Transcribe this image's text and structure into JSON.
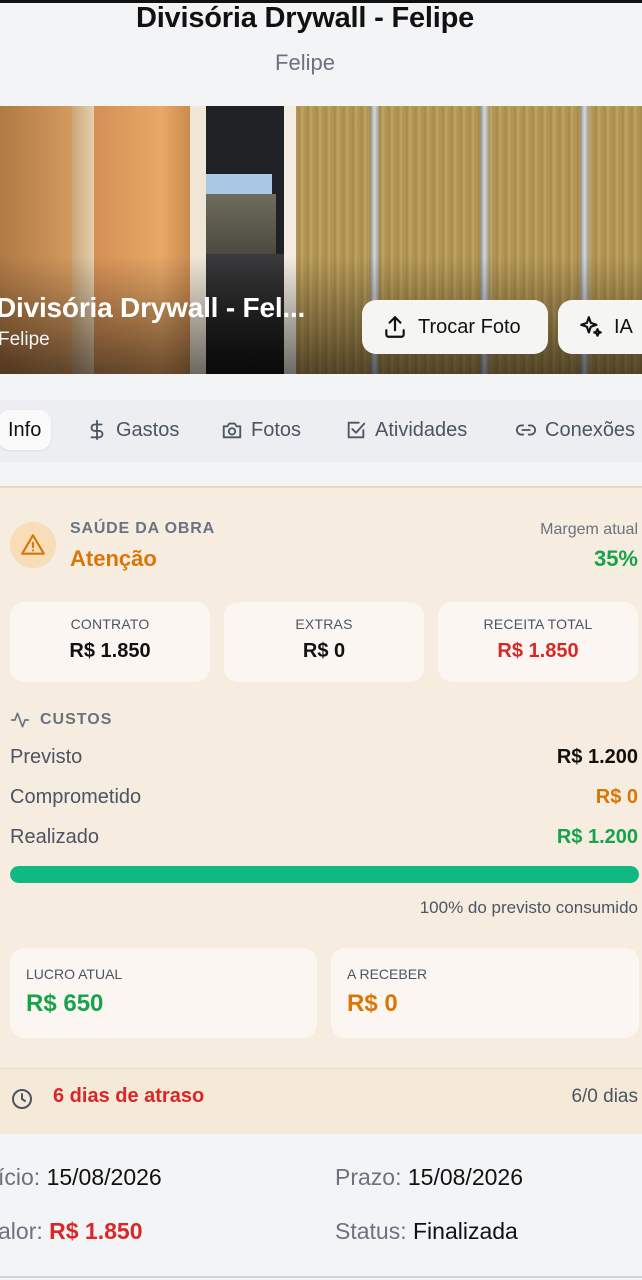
{
  "header": {
    "title": "Divisória Drywall - Felipe",
    "subtitle": "Felipe"
  },
  "hero": {
    "title": "Divisória Drywall - Fel...",
    "subtitle": "Felipe",
    "change_photo_label": "Trocar Foto",
    "ai_label": "IA"
  },
  "tabs": [
    {
      "label": "Info",
      "icon": "info",
      "active": true
    },
    {
      "label": "Gastos",
      "icon": "dollar-icon"
    },
    {
      "label": "Fotos",
      "icon": "camera-icon"
    },
    {
      "label": "Atividades",
      "icon": "checkbox-icon"
    },
    {
      "label": "Conexões",
      "icon": "link-icon"
    }
  ],
  "health": {
    "label": "SAÚDE DA OBRA",
    "status": "Atenção",
    "margin_label": "Margem atual",
    "margin_value": "35%"
  },
  "summary": [
    {
      "label": "CONTRATO",
      "value": "R$ 1.850"
    },
    {
      "label": "EXTRAS",
      "value": "R$ 0"
    },
    {
      "label": "RECEITA TOTAL",
      "value": "R$ 1.850"
    }
  ],
  "costs": {
    "heading": "CUSTOS",
    "rows": [
      {
        "label": "Previsto",
        "value": "R$ 1.200"
      },
      {
        "label": "Comprometido",
        "value": "R$ 0"
      },
      {
        "label": "Realizado",
        "value": "R$ 1.200"
      }
    ],
    "progress_fraction": 1.0,
    "consumed_text": "100% do previsto consumido"
  },
  "profit": {
    "label": "LUCRO ATUAL",
    "value": "R$ 650"
  },
  "receivable": {
    "label": "A RECEBER",
    "value": "R$ 0"
  },
  "delay": {
    "text": "6 dias de atraso",
    "days": "6/0 dias"
  },
  "details": {
    "start_label": "ício:",
    "start_value": "15/08/2026",
    "deadline_label": "Prazo:",
    "deadline_value": "15/08/2026",
    "value_label": "alor:",
    "value_value": "R$ 1.850",
    "status_label": "Status:",
    "status_value": "Finalizada"
  },
  "colors": {
    "warning": "#d97706",
    "success": "#16a34a",
    "danger": "#dc2626",
    "progress": "#10b981",
    "card_bg": "#f6ecdf"
  }
}
